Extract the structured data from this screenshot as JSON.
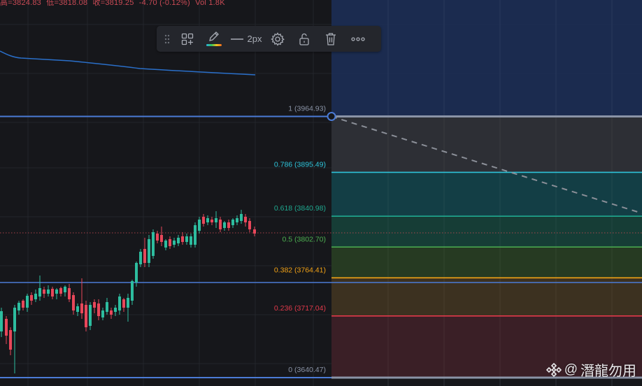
{
  "ohlc": {
    "open": "高=3824.83",
    "low": "低=3818.08",
    "close": "收=3819.25",
    "change": "-4.70 (-0.12%)",
    "volume": "Vol 1.8K"
  },
  "toolbar": {
    "icons": [
      "drag-handle-icon",
      "add-template-icon",
      "pencil-icon",
      "line-style-icon",
      "settings-icon",
      "unlock-icon",
      "trash-icon",
      "more-icon"
    ],
    "line_width_label": "2px"
  },
  "fib_levels": [
    {
      "ratio": "1",
      "price": 3964.93,
      "label": "1 (3964.93)",
      "color": "#8a93a6"
    },
    {
      "ratio": "0.786",
      "price": 3895.49,
      "label": "0.786 (3895.49)",
      "color": "#2ec4da"
    },
    {
      "ratio": "0.618",
      "price": 3840.98,
      "label": "0.618 (3840.98)",
      "color": "#1fa88f"
    },
    {
      "ratio": "0.5",
      "price": 3802.7,
      "label": "0.5 (3802.70)",
      "color": "#4caf50"
    },
    {
      "ratio": "0.382",
      "price": 3764.41,
      "label": "0.382 (3764.41)",
      "color": "#f2a216"
    },
    {
      "ratio": "0.236",
      "price": 3717.04,
      "label": "0.236 (3717.04)",
      "color": "#e0394a"
    },
    {
      "ratio": "0",
      "price": 3640.47,
      "label": "0 (3640.47)",
      "color": "#8a93a6"
    }
  ],
  "colors": {
    "up": "#2dbd9f",
    "down": "#e8475a",
    "ma": "#2a6fc9",
    "hline": "#4b7bd6",
    "zone_top": "#1c2d55"
  },
  "watermark": {
    "at": "@",
    "name": "潛龍勿用"
  }
}
